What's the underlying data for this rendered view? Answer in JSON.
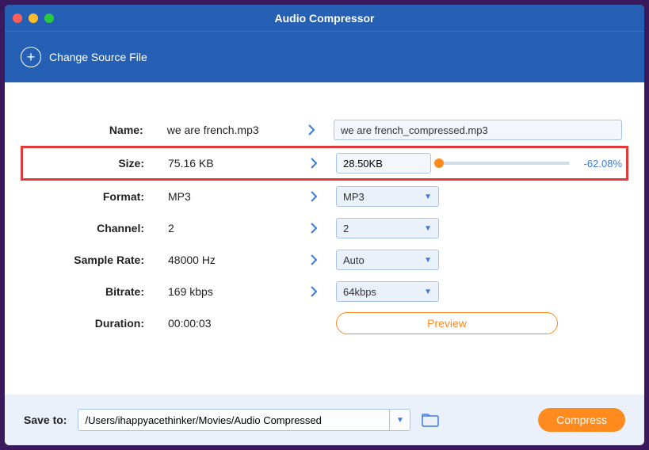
{
  "window": {
    "title": "Audio Compressor"
  },
  "toolbar": {
    "change_source": "Change Source File"
  },
  "fields": {
    "name": {
      "label": "Name:",
      "orig": "we are french.mp3",
      "output": "we are french_compressed.mp3"
    },
    "size": {
      "label": "Size:",
      "orig": "75.16 KB",
      "output": "28.50KB",
      "percent": "-62.08%"
    },
    "format": {
      "label": "Format:",
      "orig": "MP3",
      "output": "MP3"
    },
    "channel": {
      "label": "Channel:",
      "orig": "2",
      "output": "2"
    },
    "sample_rate": {
      "label": "Sample Rate:",
      "orig": "48000 Hz",
      "output": "Auto"
    },
    "bitrate": {
      "label": "Bitrate:",
      "orig": "169 kbps",
      "output": "64kbps"
    },
    "duration": {
      "label": "Duration:",
      "orig": "00:00:03"
    }
  },
  "preview": "Preview",
  "footer": {
    "save_label": "Save to:",
    "path": "/Users/ihappyacethinker/Movies/Audio Compressed",
    "compress": "Compress"
  }
}
